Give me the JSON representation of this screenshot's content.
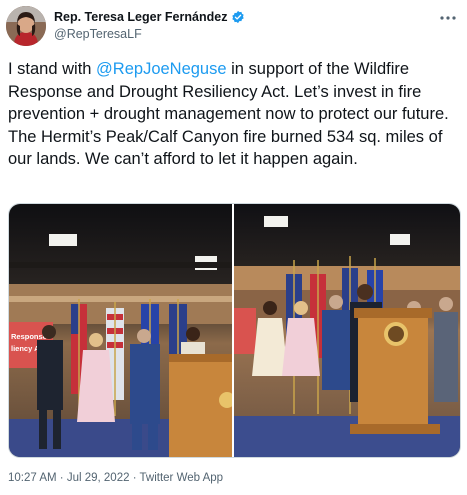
{
  "author": {
    "name": "Rep. Teresa Leger Fernández",
    "handle": "@RepTeresaLF"
  },
  "tweet": {
    "text_before": "I stand with ",
    "mention": "@RepJoeNeguse",
    "text_after": " in support of the Wildfire Response and Drought Resiliency Act. Let’s invest in fire prevention + drought management now to protect our future. The Hermit’s Peak/Calf Canyon fire burned 534 sq. miles of our lands. We can’t afford to let it happen again."
  },
  "media": {
    "sign_text_left": "Response\nliency Act"
  },
  "footer": {
    "time": "10:27 AM",
    "separator": " · ",
    "date": "Jul 29, 2022",
    "source": "Twitter Web App"
  },
  "colors": {
    "link": "#1d9bf0",
    "secondary_text": "#536471",
    "verified": "#1d9bf0"
  }
}
